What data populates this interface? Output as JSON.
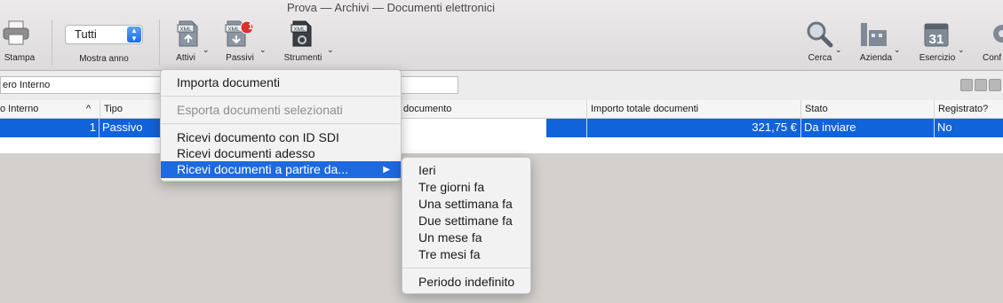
{
  "window": {
    "title": "Prova — Archivi — Documenti elettronici"
  },
  "toolbar": {
    "stampa": "Stampa",
    "year_select_value": "Tutti",
    "mostra_anno": "Mostra anno",
    "attivi": "Attivi",
    "passivi": "Passivi",
    "passivi_badge": "1",
    "strumenti": "Strumenti",
    "xml_tag": "XML",
    "cerca": "Cerca",
    "azienda": "Azienda",
    "esercizio": "Esercizio",
    "esercizio_day": "31",
    "config": "Conf"
  },
  "search": {
    "field1_value": "ero Interno",
    "field2_value": ""
  },
  "table": {
    "headers": {
      "numero": "o Interno",
      "sort_icon": "^",
      "tipo": "Tipo",
      "documento": "documento",
      "importo": "Importo totale documenti",
      "stato": "Stato",
      "registrato": "Registrato?"
    },
    "row": {
      "numero": "1",
      "tipo": "Passivo",
      "importo": "321,75 €",
      "stato": "Da inviare",
      "registrato": "No"
    }
  },
  "menu": {
    "importa": "Importa documenti",
    "esporta": "Esporta documenti selezionati",
    "ricevi_id": "Ricevi documento con ID SDI",
    "ricevi_adesso": "Ricevi documenti adesso",
    "ricevi_da": "Ricevi documenti a partire da...",
    "arrow": "▶"
  },
  "submenu": {
    "items": [
      "Ieri",
      "Tre giorni fa",
      "Una settimana fa",
      "Due settimane fa",
      "Un mese fa",
      "Tre mesi fa"
    ],
    "periodo": "Periodo indefinito"
  },
  "colors": {
    "selection": "#1163d9",
    "menu_highlight": "#1d6ae0",
    "badge": "#e0302b"
  }
}
